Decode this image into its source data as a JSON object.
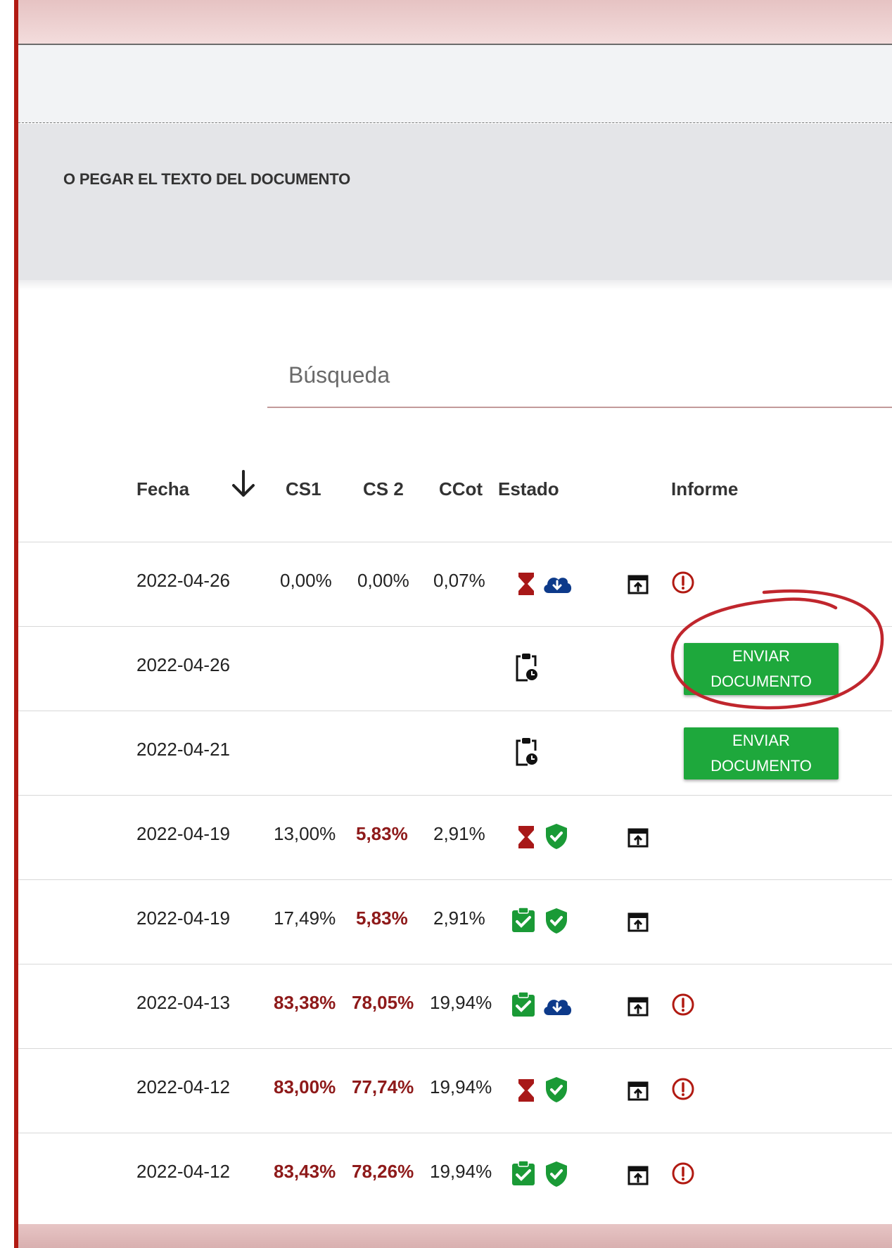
{
  "paste_panel": {
    "label": "O PEGAR EL TEXTO DEL DOCUMENTO"
  },
  "search": {
    "placeholder": "Búsqueda"
  },
  "table": {
    "headers": {
      "fecha": "Fecha",
      "cs1": "CS1",
      "cs2": "CS 2",
      "ccot": "CCot",
      "estado": "Estado",
      "informe": "Informe"
    },
    "sort_icon": "arrow-down-icon",
    "send_button": {
      "line1": "ENVIAR",
      "line2": "DOCUMENTO"
    },
    "rows": [
      {
        "fecha": "2022-04-26",
        "cs1": "0,00%",
        "cs2": "0,00%",
        "ccot": "0,07%",
        "status": [
          "hourglass-icon",
          "cloud-download-icon"
        ],
        "report": [
          "report-icon",
          "alert-icon"
        ]
      },
      {
        "fecha": "2022-04-26",
        "cs1": "",
        "cs2": "",
        "ccot": "",
        "status": [
          "clipboard-clock-icon"
        ],
        "report": [
          "send-button"
        ]
      },
      {
        "fecha": "2022-04-21",
        "cs1": "",
        "cs2": "",
        "ccot": "",
        "status": [
          "clipboard-clock-icon"
        ],
        "report": [
          "send-button"
        ]
      },
      {
        "fecha": "2022-04-19",
        "cs1": "13,00%",
        "cs2": "5,83%",
        "ccot": "2,91%",
        "status": [
          "hourglass-icon",
          "shield-check-icon"
        ],
        "report": [
          "report-icon"
        ]
      },
      {
        "fecha": "2022-04-19",
        "cs1": "17,49%",
        "cs2": "5,83%",
        "ccot": "2,91%",
        "status": [
          "clipboard-check-icon",
          "shield-check-icon"
        ],
        "report": [
          "report-icon"
        ]
      },
      {
        "fecha": "2022-04-13",
        "cs1": "83,38%",
        "cs2": "78,05%",
        "ccot": "19,94%",
        "status": [
          "clipboard-check-icon",
          "cloud-download-icon"
        ],
        "report": [
          "report-icon",
          "alert-icon"
        ]
      },
      {
        "fecha": "2022-04-12",
        "cs1": "83,00%",
        "cs2": "77,74%",
        "ccot": "19,94%",
        "status": [
          "hourglass-icon",
          "shield-check-icon"
        ],
        "report": [
          "report-icon",
          "alert-icon"
        ]
      },
      {
        "fecha": "2022-04-12",
        "cs1": "83,43%",
        "cs2": "78,26%",
        "ccot": "19,94%",
        "status": [
          "clipboard-check-icon",
          "shield-check-icon"
        ],
        "report": [
          "report-icon",
          "alert-icon"
        ]
      }
    ]
  },
  "colors": {
    "accent_red": "#b11a12",
    "value_red": "#8e1a1a",
    "button_green": "#1ea83c",
    "shield_green": "#1a9a36",
    "cloud_blue": "#0d3a8a",
    "annotation_red": "#c0262d"
  },
  "annotation": "red-hand-drawn-circle"
}
